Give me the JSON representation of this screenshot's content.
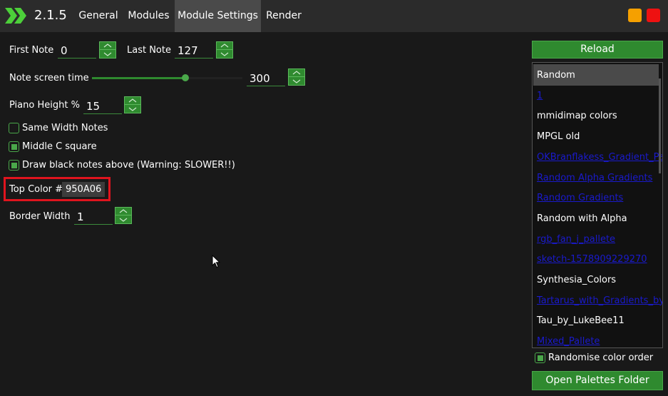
{
  "app": {
    "version": "2.1.5",
    "tabs": [
      "General",
      "Modules",
      "Module Settings",
      "Render"
    ],
    "active_tab": "Module Settings",
    "colors": {
      "accent": "#2f8a2f",
      "min_btn": "#f5a000",
      "close_btn": "#ee1111",
      "highlight_box": "#e0141e"
    }
  },
  "settings": {
    "first_note": {
      "label": "First Note",
      "value": "0"
    },
    "last_note": {
      "label": "Last Note",
      "value": "127"
    },
    "note_screen_time": {
      "label": "Note screen time",
      "value": "300",
      "slider_fraction": 0.62
    },
    "piano_height": {
      "label": "Piano Height %",
      "value": "15"
    },
    "same_width": {
      "label": "Same Width Notes",
      "checked": false
    },
    "middle_c": {
      "label": "Middle C square",
      "checked": true
    },
    "black_above": {
      "label": "Draw black notes above (Warning: SLOWER!!)",
      "checked": true
    },
    "top_color": {
      "label": "Top Color #",
      "value": "950A06"
    },
    "border_width": {
      "label": "Border Width",
      "value": "1"
    }
  },
  "palettes": {
    "reload_label": "Reload",
    "items": [
      {
        "label": "Random",
        "color": "#ffffff",
        "selected": true
      },
      {
        "label": "1",
        "color": "#1a1acc"
      },
      {
        "label": "mmidimap colors",
        "color": "#ffffff"
      },
      {
        "label": "MPGL old",
        "color": "#ffffff"
      },
      {
        "label": "OKBranflakess_Gradient_Pal",
        "color": "#1a1acc"
      },
      {
        "label": "Random Alpha Gradients",
        "color": "#1a1acc"
      },
      {
        "label": "Random Gradients",
        "color": "#1a1acc"
      },
      {
        "label": "Random with Alpha",
        "color": "#ffffff"
      },
      {
        "label": "rgb_fan_j_pallete",
        "color": "#1a1acc"
      },
      {
        "label": "sketch-1578909229270",
        "color": "#1a1acc"
      },
      {
        "label": "Synthesia_Colors",
        "color": "#ffffff"
      },
      {
        "label": "Tartarus_with_Gradients_by_I",
        "color": "#1a1acc"
      },
      {
        "label": "Tau_by_LukeBee11",
        "color": "#ffffff"
      },
      {
        "label": "Mixed_Pallete",
        "color": "#1a1acc"
      }
    ],
    "randomise": {
      "label": "Randomise color order",
      "checked": true
    },
    "open_folder_label": "Open Palettes Folder"
  }
}
